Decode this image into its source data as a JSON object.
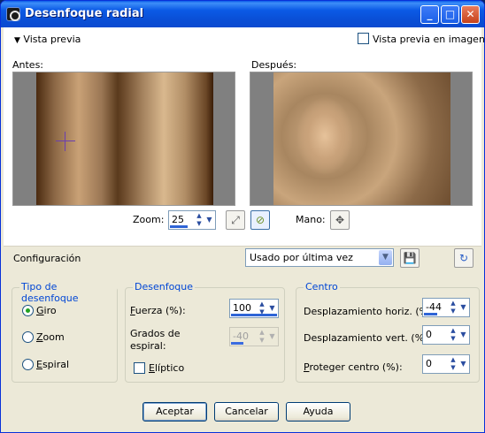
{
  "window": {
    "title": "Desenfoque radial",
    "minimize_glyph": "_",
    "maximize_glyph": "□",
    "close_glyph": "✕"
  },
  "preview": {
    "toggle_label": "Vista previa",
    "in_image_label": "Vista previa en imagen",
    "in_image_checked": false,
    "before_label": "Antes:",
    "after_label": "Después:",
    "zoom_label": "Zoom:",
    "zoom_value": "25",
    "pan_label": "Mano:",
    "icons": [
      "zoom-fit-icon",
      "zoom-lens-icon",
      "pan-hand-icon"
    ]
  },
  "config": {
    "label": "Configuración",
    "preset_value": "Usado por última vez",
    "icons": [
      "save-preset-icon",
      "reset-icon"
    ]
  },
  "blur_type": {
    "title": "Tipo de desenfoque",
    "options": [
      {
        "label": "Giro",
        "checked": true
      },
      {
        "label": "Zoom",
        "checked": false
      },
      {
        "label": "Espiral",
        "checked": false
      }
    ]
  },
  "blur": {
    "title": "Desenfoque",
    "strength_label": "Fuerza (%):",
    "strength_value": "100",
    "spiral_label_line1": "Grados de",
    "spiral_label_line2": "espiral:",
    "spiral_value": "-40",
    "elliptic_label": "Elíptico",
    "elliptic_checked": false
  },
  "center": {
    "title": "Centro",
    "h_offset_label": "Desplazamiento horiz. (%):",
    "h_offset_value": "-44",
    "v_offset_label": "Desplazamiento vert. (%):",
    "v_offset_value": "0",
    "protect_label": "Proteger centro (%):",
    "protect_value": "0"
  },
  "buttons": {
    "ok": "Aceptar",
    "cancel": "Cancelar",
    "help": "Ayuda"
  },
  "colors": {
    "title_bar": "#0a5ae8",
    "face": "#ece9d8",
    "group_title": "#0046d5"
  }
}
